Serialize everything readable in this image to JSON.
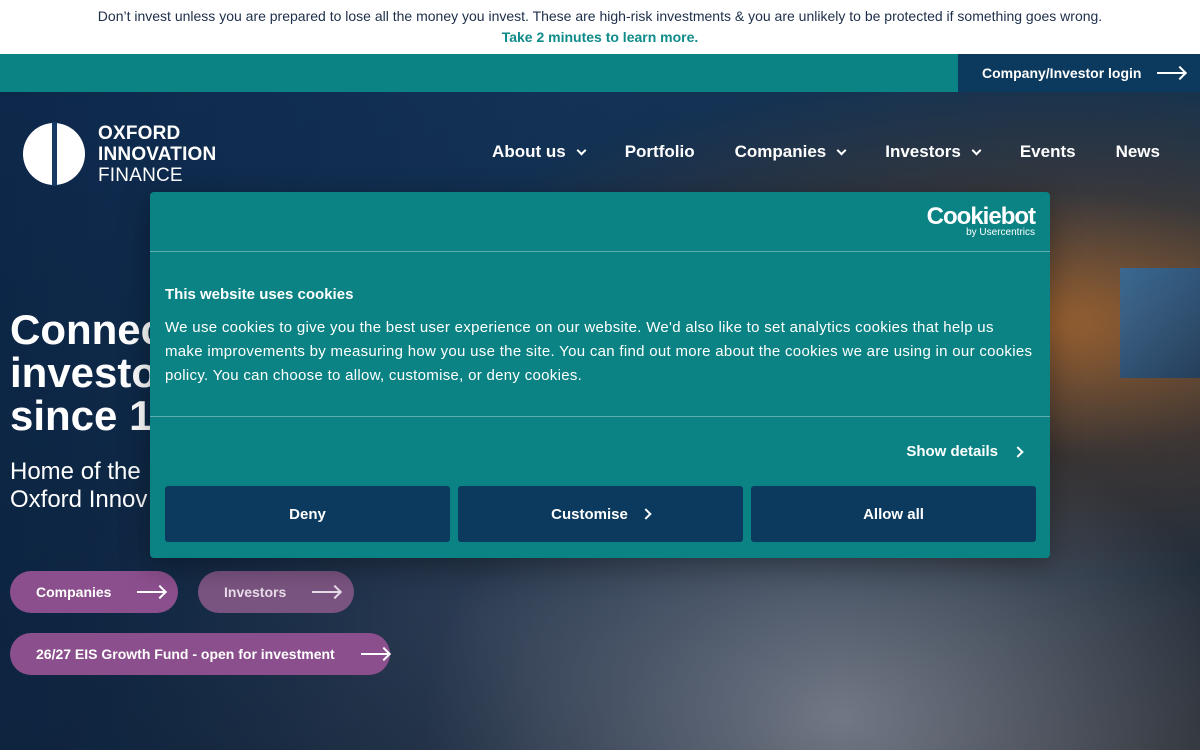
{
  "warning": {
    "text": "Don’t invest unless you are prepared to lose all the money you invest. These are high-risk investments & you are unlikely to be protected if something goes wrong.",
    "link": "Take 2 minutes to learn more."
  },
  "topbar": {
    "login_label": "Company/Investor login"
  },
  "logo": {
    "line1": "OXFORD",
    "line2": "INNOVATION",
    "line3": "FINANCE"
  },
  "nav": {
    "items": [
      {
        "label": "About us",
        "dropdown": true
      },
      {
        "label": "Portfolio",
        "dropdown": false
      },
      {
        "label": "Companies",
        "dropdown": true
      },
      {
        "label": "Investors",
        "dropdown": true
      },
      {
        "label": "Events",
        "dropdown": false
      },
      {
        "label": "News",
        "dropdown": false
      }
    ]
  },
  "hero": {
    "heading_lines": [
      "Connec",
      "investo",
      "since 1¹"
    ],
    "sub_lines": [
      "Home of the",
      "Oxford Innov"
    ],
    "buttons": {
      "companies": "Companies",
      "investors": "Investors",
      "fund": "26/27 EIS Growth Fund - open for investment"
    }
  },
  "cookie": {
    "brand": "Cookiebot",
    "brand_sub": "by Usercentrics",
    "title": "This website uses cookies",
    "text": "We use cookies to give you the best user experience on our website. We'd also like to set analytics cookies that help us make improvements by measuring how you use the site. You can find out more about the cookies we are using in our cookies policy. You can choose to allow, customise, or deny cookies.",
    "show_details": "Show details",
    "deny": "Deny",
    "customise": "Customise",
    "allow_all": "Allow all"
  },
  "colors": {
    "teal": "#0b8384",
    "navy": "#0b3a5e",
    "purple": "#8b4f8d"
  }
}
